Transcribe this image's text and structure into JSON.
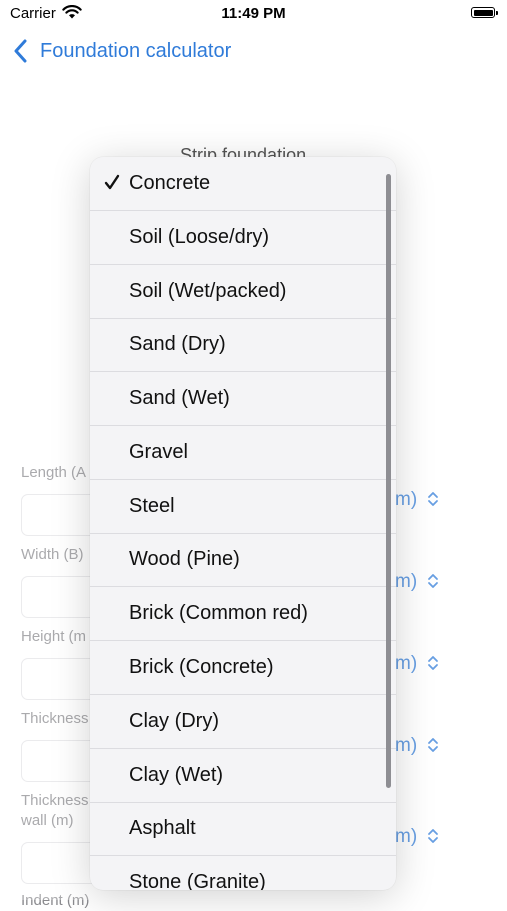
{
  "status_bar": {
    "carrier": "Carrier",
    "time": "11:49 PM"
  },
  "nav": {
    "back_label": "Foundation calculator"
  },
  "background": {
    "section_title": "Strip foundation",
    "fields": [
      {
        "label": "Length (A"
      },
      {
        "label": "Width (B)"
      },
      {
        "label": "Height (m"
      },
      {
        "label": "Thickness"
      },
      {
        "label": "Thickness\nwall (m)"
      },
      {
        "label": "Indent (m)"
      }
    ],
    "unit_suffix": "m)"
  },
  "menu": {
    "selected": "Concrete",
    "items": [
      "Concrete",
      "Soil (Loose/dry)",
      "Soil (Wet/packed)",
      "Sand (Dry)",
      "Sand (Wet)",
      "Gravel",
      "Steel",
      "Wood (Pine)",
      "Brick (Common red)",
      "Brick (Concrete)",
      "Clay (Dry)",
      "Clay (Wet)",
      "Asphalt",
      "Stone (Granite)"
    ]
  },
  "colors": {
    "accent": "#2f7bd9",
    "label_gray": "#8a8a8e",
    "menu_bg": "#f4f4f6"
  }
}
